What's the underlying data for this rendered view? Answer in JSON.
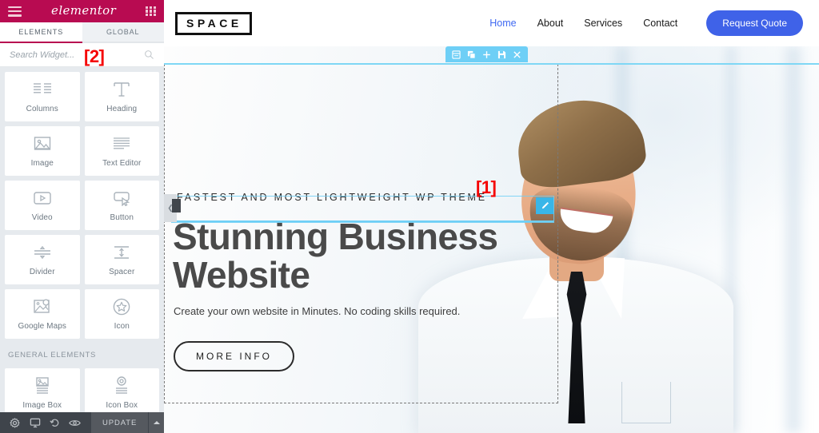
{
  "editor": {
    "brand": "elementor",
    "brand_color": "#b80b51",
    "menu_icon": "hamburger-icon",
    "apps_icon": "grid-apps-icon",
    "tabs": [
      {
        "label": "ELEMENTS",
        "active": true
      },
      {
        "label": "GLOBAL",
        "active": false
      }
    ],
    "search": {
      "placeholder": "Search Widget...",
      "value": "",
      "icon": "search-icon"
    },
    "widget_groups": [
      {
        "title": "",
        "widgets": [
          {
            "label": "Columns",
            "icon": "columns-icon"
          },
          {
            "label": "Heading",
            "icon": "heading-t-icon"
          },
          {
            "label": "Image",
            "icon": "image-icon"
          },
          {
            "label": "Text Editor",
            "icon": "text-editor-icon"
          },
          {
            "label": "Video",
            "icon": "video-play-icon"
          },
          {
            "label": "Button",
            "icon": "button-cursor-icon"
          },
          {
            "label": "Divider",
            "icon": "divider-icon"
          },
          {
            "label": "Spacer",
            "icon": "spacer-icon"
          },
          {
            "label": "Google Maps",
            "icon": "google-maps-pin-icon"
          },
          {
            "label": "Icon",
            "icon": "star-circle-icon"
          }
        ]
      },
      {
        "title": "GENERAL ELEMENTS",
        "widgets": [
          {
            "label": "Image Box",
            "icon": "image-box-icon"
          },
          {
            "label": "Icon Box",
            "icon": "icon-box-icon"
          }
        ]
      }
    ],
    "footer": {
      "settings_label": "settings-gear-icon",
      "responsive_label": "responsive-monitor-icon",
      "history_label": "history-revert-icon",
      "preview_label": "preview-eye-icon",
      "update_label": "UPDATE",
      "caret_label": "caret-up-icon"
    }
  },
  "site": {
    "logo": "SPACE",
    "nav": [
      {
        "label": "Home",
        "active": true
      },
      {
        "label": "About",
        "active": false
      },
      {
        "label": "Services",
        "active": false
      },
      {
        "label": "Contact",
        "active": false
      }
    ],
    "cta": {
      "label": "Request Quote",
      "color": "#3f62e8"
    },
    "hero": {
      "tagline": "FASTEST AND MOST LIGHTWEIGHT WP THEME",
      "headline": "Stunning Business Website",
      "subline": "Create your own website in Minutes. No coding skills required.",
      "button": "MORE INFO"
    }
  },
  "overlay": {
    "accent_color": "#6ecff6",
    "section_toolbar": [
      {
        "name": "edit-section-icon",
        "title": "Edit Section"
      },
      {
        "name": "duplicate-section-icon",
        "title": "Duplicate Section"
      },
      {
        "name": "add-section-icon",
        "title": "Add Section"
      },
      {
        "name": "save-section-icon",
        "title": "Save Section"
      },
      {
        "name": "delete-section-icon",
        "title": "Delete Section"
      }
    ],
    "widget_edit_icon": "pencil-edit-icon",
    "column_handle_icon": "column-handle-icon"
  },
  "annotations": [
    {
      "id": "1",
      "label": "[1]",
      "color": "#f50000"
    },
    {
      "id": "2",
      "label": "[2]",
      "color": "#f50000"
    }
  ]
}
